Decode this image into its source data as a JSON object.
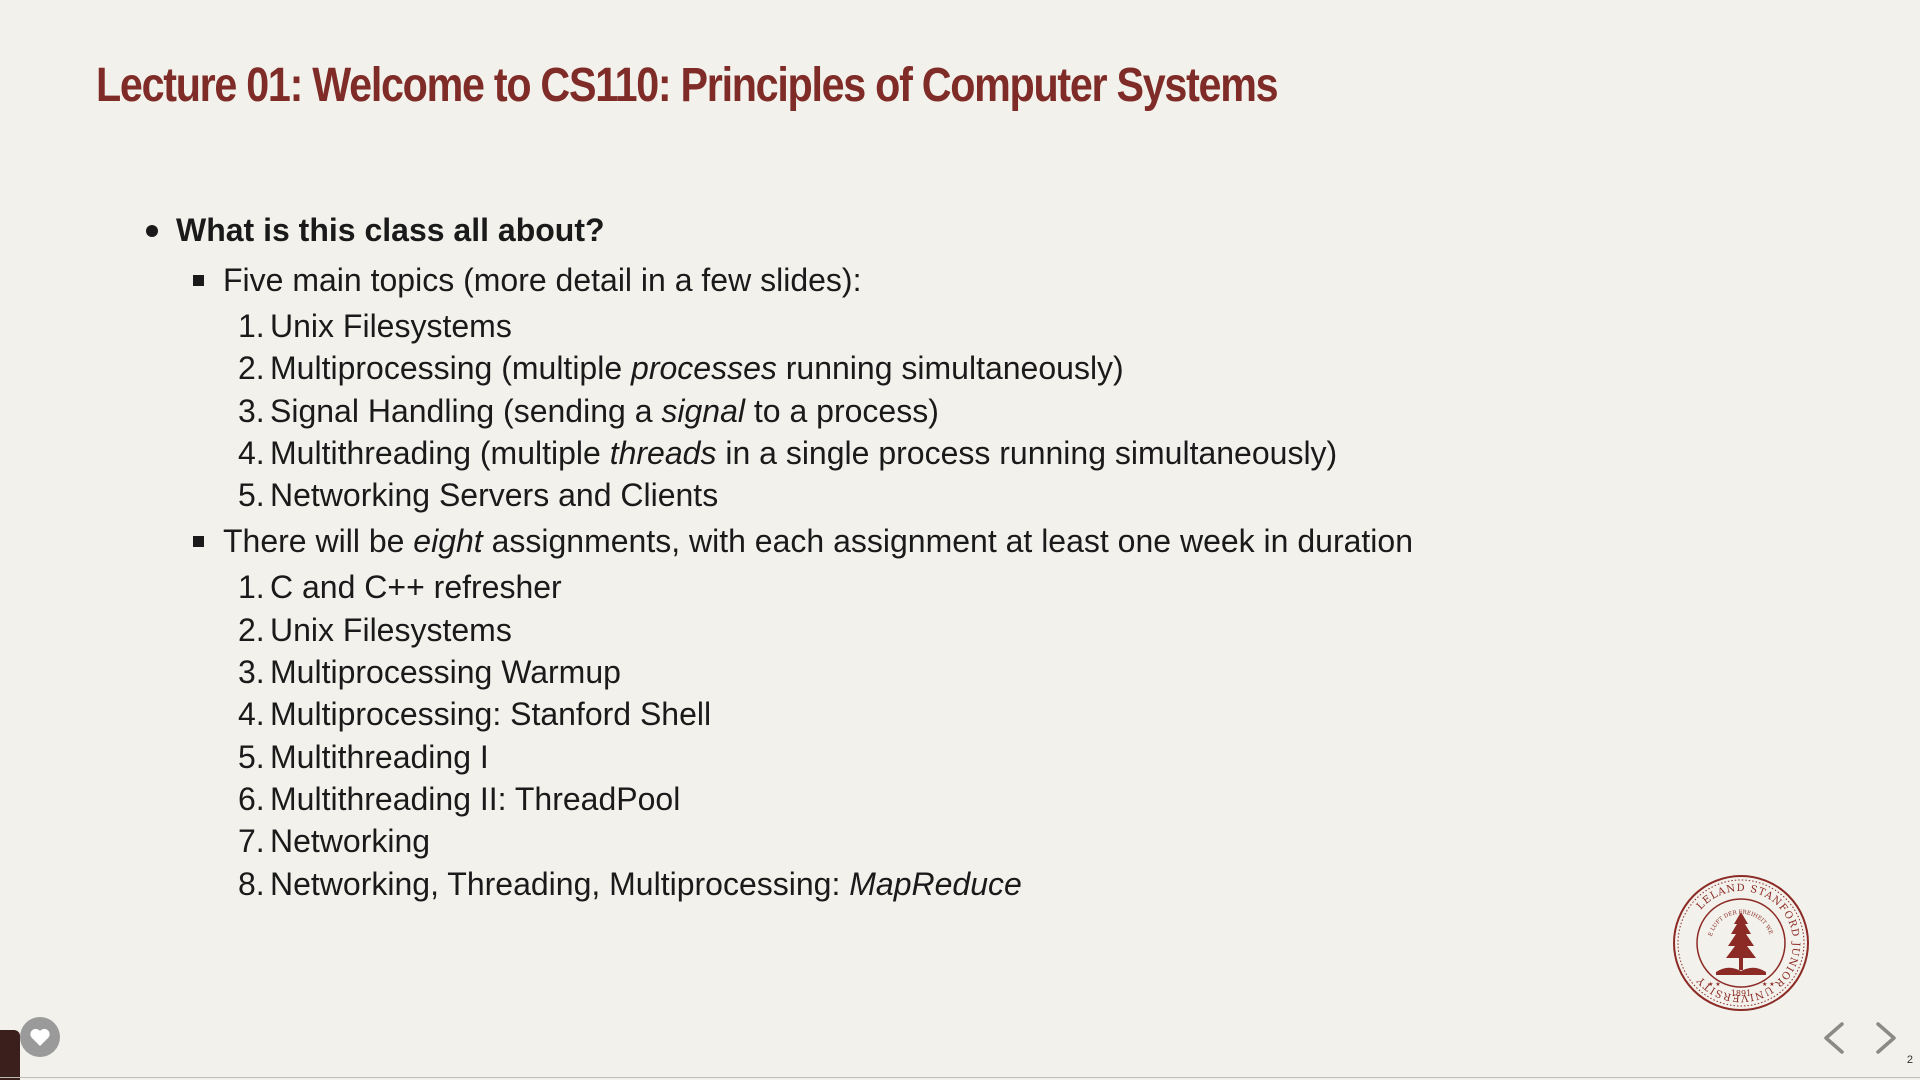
{
  "slide": {
    "title": "Lecture 01: Welcome to CS110: Principles of Computer Systems",
    "bullet": "What is this class all about?",
    "topics_heading": "Five main topics (more detail in a few slides):",
    "topics": [
      {
        "num": "1.",
        "text": "Unix Filesystems"
      },
      {
        "num": "2.",
        "pre": "Multiprocessing (multiple ",
        "em": "processes",
        "post": " running simultaneously)"
      },
      {
        "num": "3.",
        "pre": "Signal Handling (sending a ",
        "em": "signal",
        "post": " to a process)"
      },
      {
        "num": "4.",
        "pre": "Multithreading (multiple ",
        "em": "threads",
        "post": " in a single process running simultaneously)"
      },
      {
        "num": "5.",
        "text": "Networking Servers and Clients"
      }
    ],
    "assignments_heading": {
      "pre": "There will be ",
      "em": "eight",
      "post": " assignments, with each assignment at least one week in duration"
    },
    "assignments": [
      {
        "num": "1.",
        "text": "C and C++ refresher"
      },
      {
        "num": "2.",
        "text": "Unix Filesystems"
      },
      {
        "num": "3.",
        "text": "Multiprocessing Warmup"
      },
      {
        "num": "4.",
        "text": "Multiprocessing: Stanford Shell"
      },
      {
        "num": "5.",
        "text": "Multithreading I"
      },
      {
        "num": "6.",
        "text": "Multithreading II: ThreadPool"
      },
      {
        "num": "7.",
        "text": "Networking"
      },
      {
        "num": "8.",
        "pre": "Networking, Threading, Multiprocessing: ",
        "em": "MapReduce"
      }
    ],
    "slide_number": "2"
  },
  "seal": {
    "ring_text": "LELAND STANFORD JUNIOR UNIVERSITY",
    "year": "1891",
    "motto": "DIE LUFT DER FREIHEIT WEHT"
  },
  "icons": {
    "like": "heart-icon",
    "prev": "chevron-left-icon",
    "next": "chevron-right-icon",
    "seal": "stanford-seal-icon"
  },
  "colors": {
    "background": "#f2f1eb",
    "title": "#7f2b27",
    "text": "#1a1a1a",
    "seal": "#8c2a26"
  }
}
